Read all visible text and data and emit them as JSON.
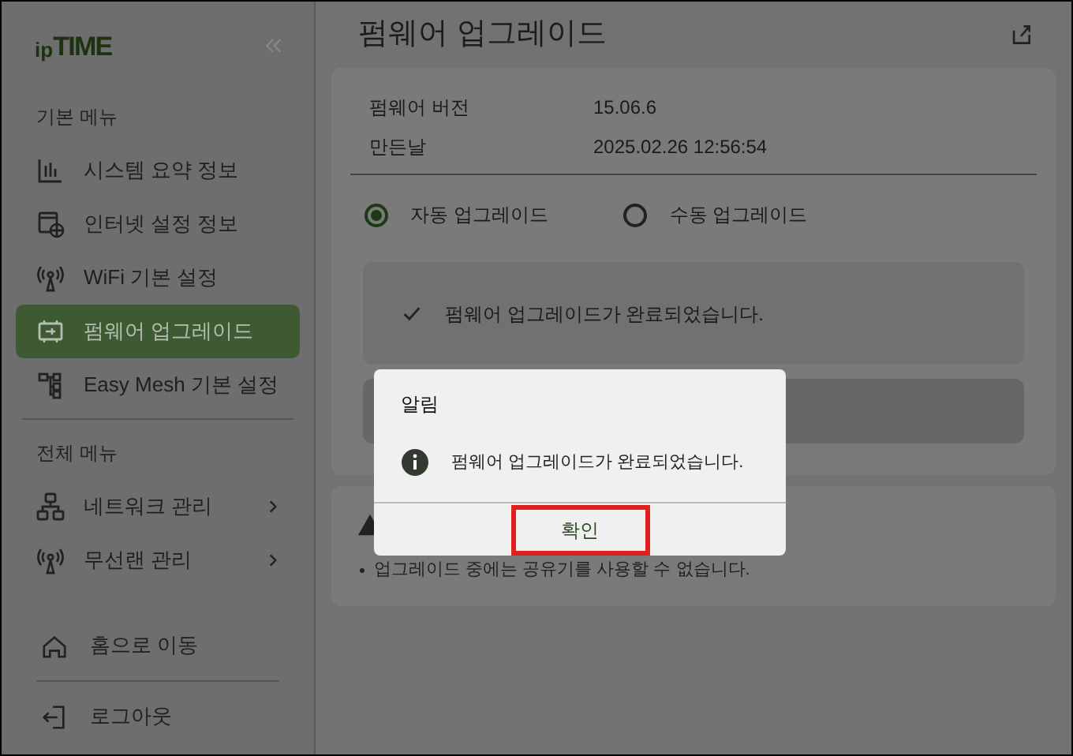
{
  "sidebar": {
    "logo": {
      "prefix": "ip",
      "brand": "TIME"
    },
    "sections": [
      {
        "title": "기본 메뉴",
        "items": [
          {
            "label": "시스템 요약 정보",
            "selected": false,
            "expandable": false
          },
          {
            "label": "인터넷 설정 정보",
            "selected": false,
            "expandable": false
          },
          {
            "label": "WiFi 기본 설정",
            "selected": false,
            "expandable": false
          },
          {
            "label": "펌웨어 업그레이드",
            "selected": true,
            "expandable": false
          },
          {
            "label": "Easy Mesh 기본 설정",
            "selected": false,
            "expandable": false
          }
        ]
      },
      {
        "title": "전체 메뉴",
        "items": [
          {
            "label": "네트워크 관리",
            "selected": false,
            "expandable": true
          },
          {
            "label": "무선랜 관리",
            "selected": false,
            "expandable": true
          }
        ]
      }
    ],
    "footer": [
      {
        "label": "홈으로 이동"
      },
      {
        "label": "로그아웃"
      }
    ]
  },
  "page": {
    "title": "펌웨어 업그레이드",
    "info": [
      {
        "label": "펌웨어 버전",
        "value": "15.06.6"
      },
      {
        "label": "만든날",
        "value": "2025.02.26 12:56:54"
      }
    ],
    "modes": [
      {
        "label": "자동 업그레이드",
        "selected": true
      },
      {
        "label": "수동 업그레이드",
        "selected": false
      }
    ],
    "status": "펌웨어 업그레이드가 완료되었습니다.",
    "notes": [
      "업그레이드 중에는 공유기를 사용할 수 없습니다."
    ]
  },
  "dialog": {
    "title": "알림",
    "message": "펌웨어 업그레이드가 완료되었습니다.",
    "button": "확인",
    "highlighted": true
  }
}
